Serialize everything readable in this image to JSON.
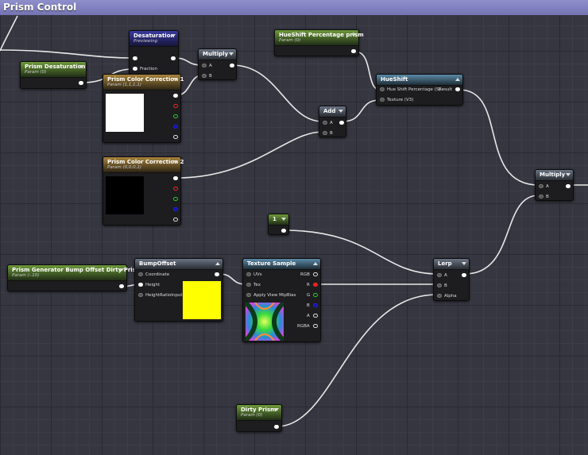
{
  "window": {
    "title": "Prism Control"
  },
  "nodes": {
    "desaturation": {
      "title": "Desaturation",
      "status": "Previewing",
      "pins": {
        "fraction": "Fraction"
      }
    },
    "prism_desaturation": {
      "title": "Prism Desaturation",
      "sub": "Param (0)"
    },
    "multiply_1": {
      "title": "Multiply",
      "pins": {
        "a": "A",
        "b": "B"
      }
    },
    "hueshift_percentage": {
      "title": "HueShift Percentage prism",
      "sub": "Param (0)"
    },
    "hueshift": {
      "title": "HueShift",
      "pins": {
        "percentage": "Hue Shift Percentage (S)",
        "texture": "Texture (V3)",
        "result": "Result"
      }
    },
    "color_correction_1": {
      "title": "Prism Color Correction 1",
      "sub": "Param (1,1,1,1)",
      "swatch": "#ffffff"
    },
    "color_correction_2": {
      "title": "Prism Color Correction 2",
      "sub": "Param (0,0,0,1)",
      "swatch": "#000000"
    },
    "add": {
      "title": "Add",
      "pins": {
        "a": "A",
        "b": "B"
      }
    },
    "multiply_2": {
      "title": "Multiply",
      "pins": {
        "a": "A",
        "b": "B"
      }
    },
    "constant_1": {
      "title": "1"
    },
    "bump_param": {
      "title": "Prism Generator Bump Offset Dirty Prism",
      "sub": "Param (-.10)"
    },
    "bump_offset": {
      "title": "BumpOffset",
      "pins": {
        "coordinate": "Coordinate",
        "height": "Height",
        "height_ratio": "HeightRatioInput"
      },
      "swatch": "#ffff00"
    },
    "texture_sample": {
      "title": "Texture Sample",
      "pins": {
        "uvs": "UVs",
        "tex": "Tex",
        "mip": "Apply View MipBias",
        "rgb": "RGB",
        "r": "R",
        "g": "G",
        "b": "B",
        "a": "A",
        "rgba": "RGBA"
      }
    },
    "lerp": {
      "title": "Lerp",
      "pins": {
        "a": "A",
        "b": "B",
        "alpha": "Alpha"
      }
    },
    "dirty_prism": {
      "title": "Dirty Prism",
      "sub": "Param (0)"
    }
  },
  "colors": {
    "wire": "#e8e8e8",
    "param_header": "#6e9a3a",
    "vector_header": "#a8843b",
    "desaturation_header": "#3a3aa0",
    "function_header": "#5b8aa8",
    "titlebar": "#7474b3",
    "background": "#363640"
  },
  "icons": [
    "collapse-arrow-icon",
    "expand-arrow-icon",
    "output-pin-icon",
    "input-pin-icon"
  ]
}
